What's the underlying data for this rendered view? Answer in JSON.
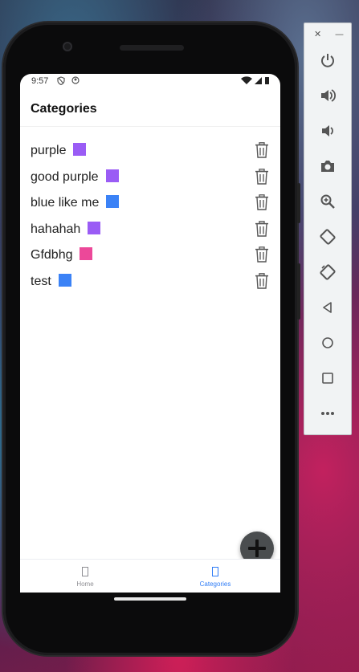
{
  "statusbar": {
    "time": "9:57"
  },
  "appbar": {
    "title": "Categories"
  },
  "categories": [
    {
      "name": "purple",
      "color": "#9a5cf5"
    },
    {
      "name": "good purple",
      "color": "#9a5cf5"
    },
    {
      "name": "blue like me",
      "color": "#3b82f6"
    },
    {
      "name": "hahahah",
      "color": "#9a5cf5"
    },
    {
      "name": "Gfdbhg",
      "color": "#ec4899"
    },
    {
      "name": "test",
      "color": "#3b82f6"
    }
  ],
  "row_action_icon": "trash-icon",
  "fab": {
    "icon": "plus-icon"
  },
  "tabs": [
    {
      "label": "Home",
      "active": false
    },
    {
      "label": "Categories",
      "active": true
    }
  ],
  "colors": {
    "active_tab": "#2f7cf6",
    "inactive_tab": "#8e8e93",
    "fab": "#4a4d4f"
  },
  "emulator_panel": {
    "window_controls": [
      "close-icon",
      "minimize-icon"
    ],
    "buttons": [
      "power-icon",
      "volume-up-icon",
      "volume-down-icon",
      "camera-icon",
      "zoom-icon",
      "rotate-left-icon",
      "rotate-right-icon",
      "back-icon",
      "home-icon",
      "overview-icon",
      "more-icon"
    ]
  }
}
